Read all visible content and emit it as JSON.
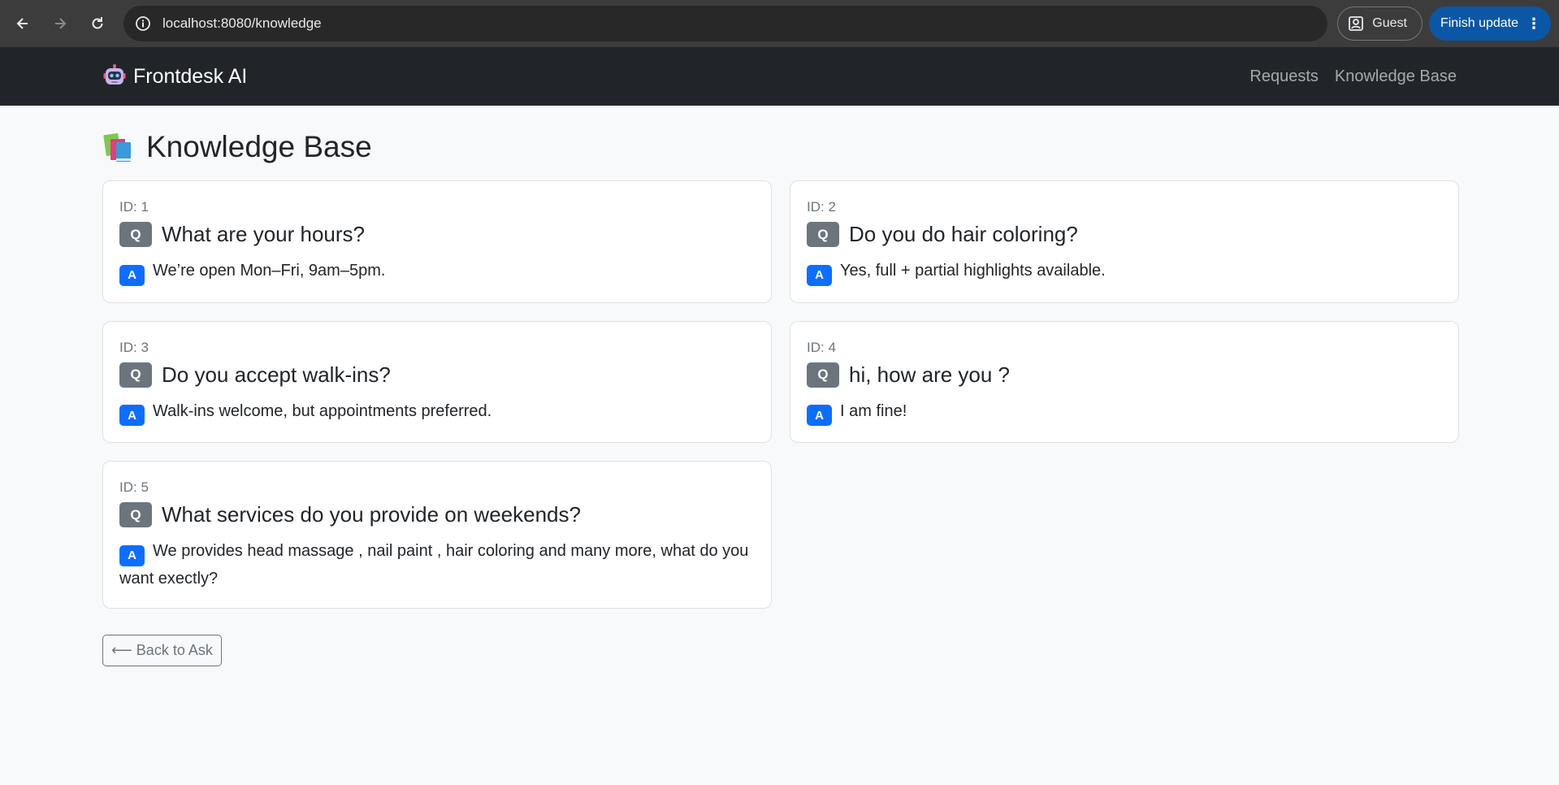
{
  "browser": {
    "url": "localhost:8080/knowledge",
    "guest_label": "Guest",
    "update_label": "Finish update"
  },
  "navbar": {
    "brand": "Frontdesk AI",
    "links": [
      "Requests",
      "Knowledge Base"
    ]
  },
  "page": {
    "title": "Knowledge Base",
    "q_badge": "Q",
    "a_badge": "A",
    "back_label": "⟵ Back to Ask"
  },
  "entries": [
    {
      "id": "ID: 1",
      "question": "What are your hours?",
      "answer": "We’re open Mon–Fri, 9am–5pm."
    },
    {
      "id": "ID: 2",
      "question": "Do you do hair coloring?",
      "answer": "Yes, full + partial highlights available."
    },
    {
      "id": "ID: 3",
      "question": "Do you accept walk-ins?",
      "answer": "Walk-ins welcome, but appointments preferred."
    },
    {
      "id": "ID: 4",
      "question": "hi, how are you ?",
      "answer": "I am fine!"
    },
    {
      "id": "ID: 5",
      "question": "What services do you provide on weekends?",
      "answer": "We provides head massage , nail paint , hair coloring and many more, what do you want exectly?"
    }
  ],
  "colors": {
    "navbar_bg": "#212529",
    "q_badge": "#6c757d",
    "a_badge": "#0d6efd",
    "update_button": "#0b57a5"
  }
}
